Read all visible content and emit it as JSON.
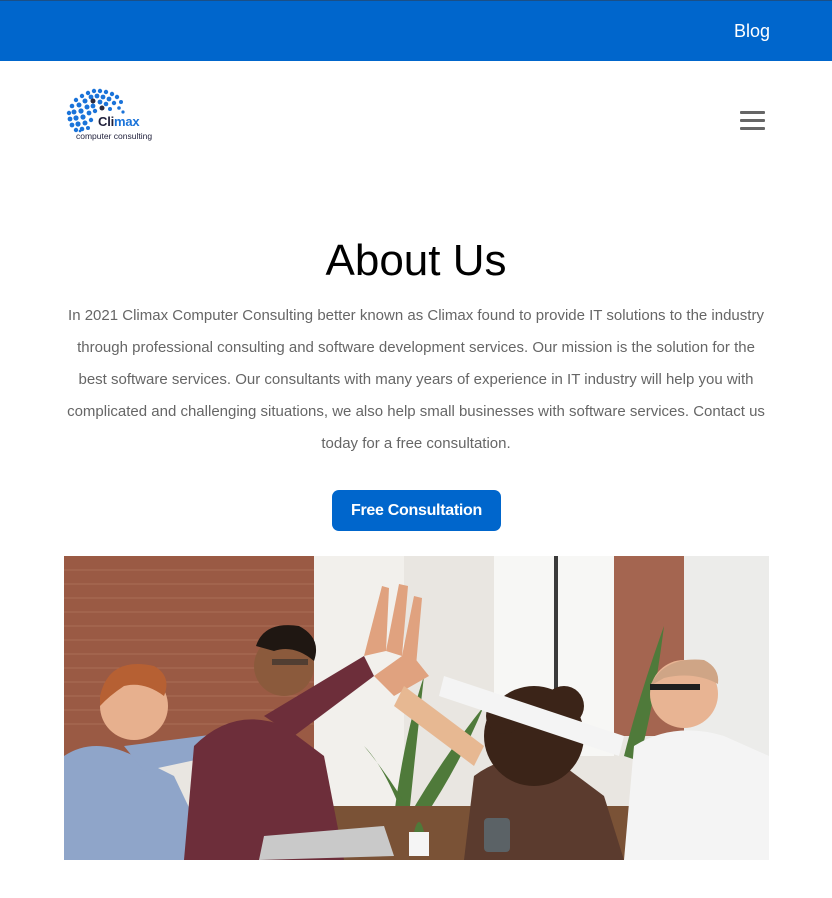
{
  "topbar": {
    "blog_label": "Blog",
    "background_color": "#0066cc"
  },
  "header": {
    "logo": {
      "brand_prefix": "Cli",
      "brand_suffix": "max",
      "tagline": "computer consulting"
    },
    "menu_icon": "hamburger-menu-icon"
  },
  "about": {
    "title": "About Us",
    "body": "In 2021 Climax Computer Consulting better known as Climax found to provide IT solutions to the industry through professional consulting and software development services. Our mission is the solution for the best software services. Our consultants with many years of experience in IT industry will help you with complicated and challenging situations, we also help small businesses with software services. Contact us today for a free consultation.",
    "cta_label": "Free Consultation"
  },
  "colors": {
    "accent": "#0066cc",
    "body_text": "#666666",
    "heading": "#000000"
  }
}
